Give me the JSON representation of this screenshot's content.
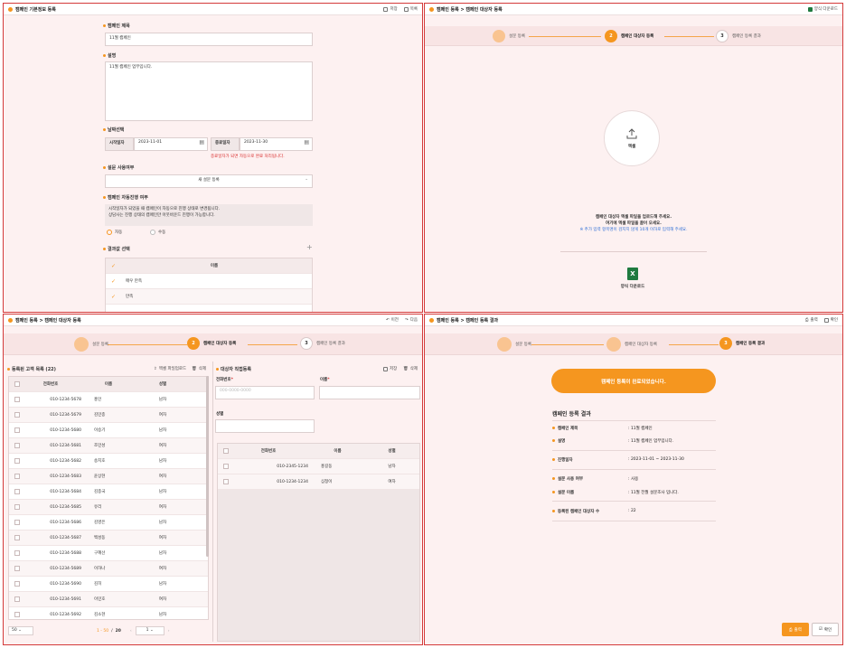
{
  "p1": {
    "title": "캠페인 기본정보 등록",
    "save": "저장",
    "list": "목록",
    "name_label": "캠페인 제목",
    "name_value": "11월 캠페인",
    "desc_label": "설명",
    "desc_value": "11월 캠페인 업무입니다.",
    "date_label": "날짜선택",
    "start_label": "시작일자",
    "start_value": "2023-11-01",
    "end_label": "종료일자",
    "end_value": "2023-11-30",
    "date_warning": "종료일자가 되면 자동으로 완료 처리됩니다.",
    "survey_label": "설문 사용여부",
    "survey_value": "새 설문 등록",
    "auto_label": "캠페인 자동진행 여부",
    "auto_desc1": "시작일자가 되었을 때 캠페인이 자동으로 진행 상태로 변경됩니다.",
    "auto_desc2": "상담사는 진행 상태의 캠페인만 아웃바운드 진행이 가능합니다.",
    "auto_opt": "자동",
    "manual_opt": "수동",
    "result_label": "결과값 선택",
    "result_col": "이름",
    "result_items": [
      "매우 만족",
      "만족"
    ]
  },
  "p2": {
    "title": "캠페인 등록 > 캠페인 대상자 등록",
    "download": "양식 다운로드",
    "steps": [
      "설문 등록",
      "캠페인 대상자 등록",
      "캠페인 등록 결과"
    ],
    "step_nums": [
      "1",
      "2",
      "3"
    ],
    "upload_label": "엑셀",
    "msg1": "캠페인 대상자 엑셀 파일을 업로드해 주세요.",
    "msg2": "여기에 엑셀 파일을 끌어 오세요.",
    "msg3": "※ 추가 입력 항목명이 검지지 않게 10개 이하로 입력해 주세요.",
    "excel_label": "양식 다운로드"
  },
  "p3": {
    "title": "캠페인 등록 > 캠페인 대상자 등록",
    "prev": "이전",
    "next": "다음",
    "list_title": "등록된 고객 목록 (22)",
    "excel_upload": "엑셀 파일업로드",
    "delete": "삭제",
    "cols": [
      "전화번호",
      "이름",
      "성별"
    ],
    "rows": [
      [
        "010-1234-5678",
        "홍인",
        "남자"
      ],
      [
        "010-1234-5679",
        "김민종",
        "여자"
      ],
      [
        "010-1234-5680",
        "이승기",
        "남자"
      ],
      [
        "010-1234-5681",
        "조민성",
        "여자"
      ],
      [
        "010-1234-5682",
        "송지호",
        "남자"
      ],
      [
        "010-1234-5683",
        "윤상현",
        "여자"
      ],
      [
        "010-1234-5684",
        "김종국",
        "남자"
      ],
      [
        "010-1234-5685",
        "유리",
        "여자"
      ],
      [
        "010-1234-5686",
        "김영은",
        "남자"
      ],
      [
        "010-1234-5687",
        "백성동",
        "여자"
      ],
      [
        "010-1234-5688",
        "구혜선",
        "남자"
      ],
      [
        "010-1234-5689",
        "이하나",
        "여자"
      ],
      [
        "010-1234-5690",
        "김히",
        "남자"
      ],
      [
        "010-1234-5691",
        "이민호",
        "여자"
      ],
      [
        "010-1234-5692",
        "김소현",
        "남자"
      ]
    ],
    "page_size": "50",
    "page_range": "1 - 50",
    "page_total": "20",
    "page_num": "1",
    "direct_title": "대상자 직접등록",
    "save": "저장",
    "delete2": "삭제",
    "phone_label": "전화번호",
    "phone_ph": "000-0000-0000",
    "name_label": "이름",
    "gender_label": "성별",
    "direct_rows": [
      [
        "010-2345-1234",
        "홍길동",
        "남자"
      ],
      [
        "010-1234-1234",
        "심청이",
        "여자"
      ]
    ]
  },
  "p4": {
    "title": "캠페인 등록 > 캠페인 등록 결과",
    "print": "출력",
    "confirm": "확인",
    "banner": "캠페인 등록이 완료되었습니다.",
    "result_title": "캠페인 등록 결과",
    "items": [
      [
        "캠페인 제목",
        ": 11월 캠페인"
      ],
      [
        "설명",
        ": 11월 캠페인 업무입니다."
      ],
      [
        "진행일자",
        ": 2023-11-01 ~ 2023-11-30"
      ],
      [
        "설문 사용 여부",
        ": 사용"
      ],
      [
        "설문 이름",
        ": 11월 전월 설문조사 입니다."
      ],
      [
        "등록된 캠페인 대상자 수",
        ": 22"
      ]
    ],
    "btn_print": "출력",
    "btn_confirm": "확인"
  },
  "colors": {
    "accent": "#f5961f",
    "border": "#d43a3a",
    "bg": "#fdf1f1"
  }
}
